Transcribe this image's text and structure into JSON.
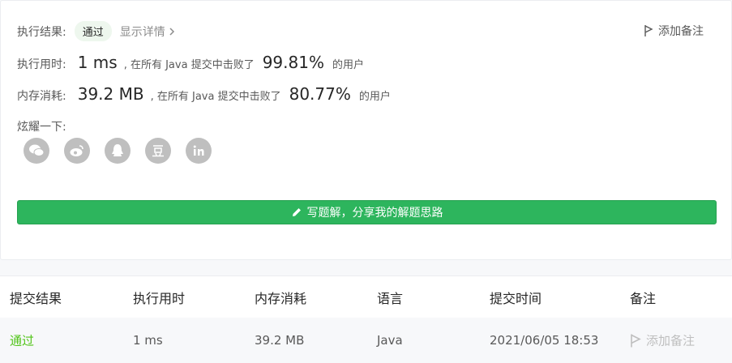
{
  "result": {
    "label": "执行结果:",
    "status": "通过",
    "detail_link": "显示详情",
    "add_note": "添加备注"
  },
  "runtime": {
    "label": "执行用时:",
    "value": "1 ms",
    "prefix": ", 在所有 Java 提交中击败了",
    "percent": "99.81%",
    "suffix": "的用户"
  },
  "memory": {
    "label": "内存消耗:",
    "value": "39.2 MB",
    "prefix": ", 在所有 Java 提交中击败了",
    "percent": "80.77%",
    "suffix": "的用户"
  },
  "share": {
    "label": "炫耀一下:",
    "icons": [
      "wechat-icon",
      "weibo-icon",
      "qq-icon",
      "douban-icon",
      "linkedin-icon"
    ]
  },
  "write_solution_button": "写题解，分享我的解题思路",
  "table": {
    "headers": [
      "提交结果",
      "执行用时",
      "内存消耗",
      "语言",
      "提交时间",
      "备注"
    ],
    "rows": [
      {
        "result": "通过",
        "runtime": "1 ms",
        "memory": "39.2 MB",
        "language": "Java",
        "time": "2021/06/05 18:53",
        "note": "添加备注"
      }
    ]
  },
  "colors": {
    "accent_green": "#2db55d",
    "pass_green": "#52c41a",
    "icon_grey": "#bfbfbf"
  }
}
